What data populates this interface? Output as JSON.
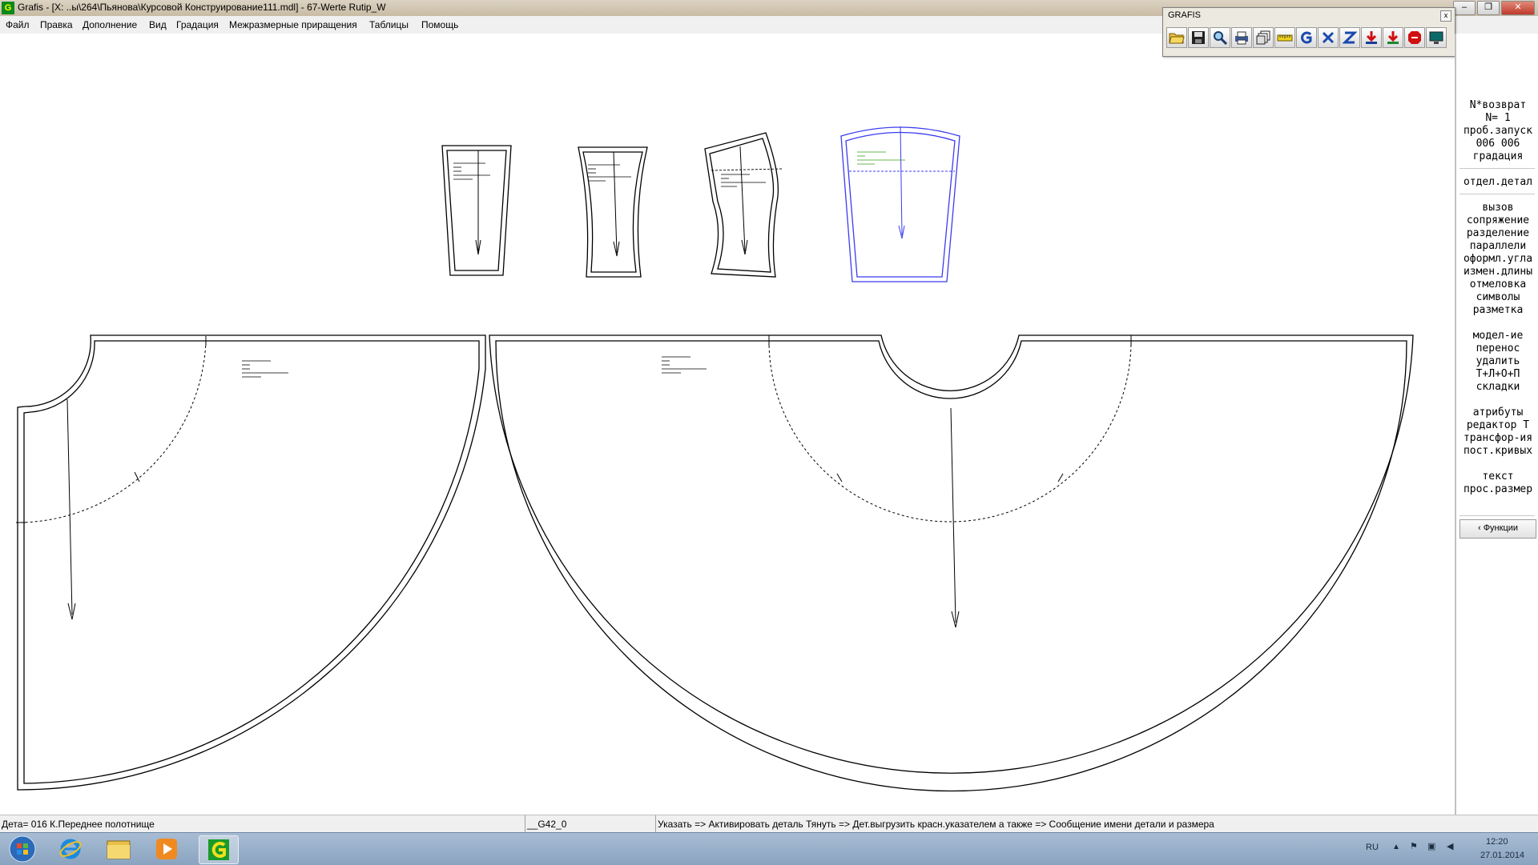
{
  "window": {
    "title": "Grafis - [X: ..ы\\264\\Пьянова\\Курсовой Конструирование111.mdl] - 67-Werte Rutip_W",
    "app_icon_label": "G",
    "controls": {
      "minimize": "‒",
      "restore": "❐",
      "close": "✕"
    }
  },
  "menu": [
    "Файл",
    "Правка",
    "Дополнение",
    "Вид",
    "Градация",
    "Межразмерные приращения",
    "Таблицы",
    "Помощь"
  ],
  "toolbar": {
    "title": "GRAFIS",
    "close": "x",
    "tools": [
      "open-folder-icon",
      "save-disk-icon",
      "zoom-magnifier-icon",
      "plot-printer-icon",
      "layers-icon",
      "ruler-icon",
      "grafis-g-icon",
      "size-x-icon",
      "size-z-icon",
      "download-red-icon",
      "download-green-icon",
      "stop-icon",
      "monitor-icon"
    ]
  },
  "right_panel": {
    "groups": [
      [
        "N*возврат",
        "N=  1",
        "проб.запуск",
        "006 006",
        "градация"
      ],
      [
        "отдел.детал"
      ],
      [
        "вызов",
        "сопряжение",
        "разделение",
        "параллели",
        "оформл.угла",
        "измен.длины",
        "отмеловка",
        "символы",
        "разметка"
      ],
      [
        "модел-ие",
        "перенос",
        "удалить",
        "Т+Л+О+П",
        "складки"
      ],
      [
        "атрибуты",
        "редактор Т",
        "трансфор-ия",
        "пост.кривых"
      ],
      [
        "текст",
        "прос.размер"
      ]
    ],
    "button": "‹ Функции"
  },
  "status": {
    "detail": "Дета= 016  К.Переднее полотнище",
    "size": "__G42_0",
    "hint": "Указать => Активировать деталь Тянуть => Дет.выгрузить красн.указателем а также => Сообщение имени детали и размера"
  },
  "taskbar": {
    "apps": [
      "windows-start-icon",
      "internet-explorer-icon",
      "file-explorer-icon",
      "media-player-icon",
      "grafis-app-icon"
    ],
    "lang": "RU",
    "time": "12:20",
    "date": "27.01.2014"
  },
  "colors": {
    "active_piece": "#3b3bf0",
    "piece_label": "#3a9a1a",
    "outline": "#000000"
  }
}
